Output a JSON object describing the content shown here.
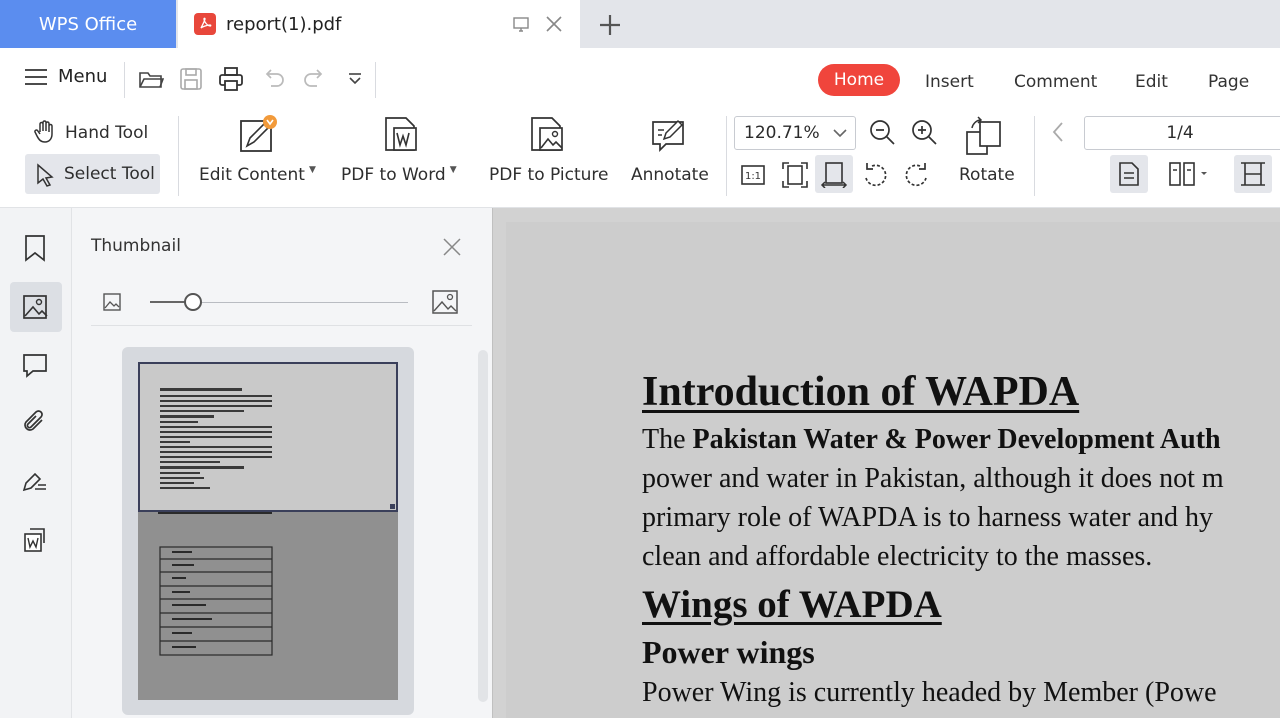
{
  "tabs": {
    "app_label": "WPS Office",
    "doc_title": "report(1).pdf"
  },
  "menu": {
    "label": "Menu"
  },
  "nav_tabs": [
    "Home",
    "Insert",
    "Comment",
    "Edit",
    "Page"
  ],
  "active_nav_tab": "Home",
  "toolbar": {
    "hand_tool": "Hand Tool",
    "select_tool": "Select Tool",
    "edit_content": "Edit Content",
    "pdf_to_word": "PDF to Word",
    "pdf_to_picture": "PDF to Picture",
    "annotate": "Annotate",
    "zoom_value": "120.71%",
    "rotate": "Rotate",
    "page_indicator": "1/4"
  },
  "thumbnail_panel": {
    "title": "Thumbnail"
  },
  "document": {
    "lines": [
      {
        "text": "Introduction of WAPDA",
        "style": "h1"
      },
      {
        "text_parts": [
          "The ",
          "Pakistan Water & Power Development Auth"
        ],
        "style": "para-mixed"
      },
      {
        "text": "power and water in Pakistan, although it does not m",
        "style": "para"
      },
      {
        "text": "primary role of WAPDA is to harness water and hy",
        "style": "para"
      },
      {
        "text": "clean and affordable electricity to the masses.",
        "style": "para"
      },
      {
        "text": "Wings of WAPDA",
        "style": "h2"
      },
      {
        "text": "Power wings",
        "style": "h3"
      },
      {
        "text": "Power Wing is currently headed by Member (Powe",
        "style": "para"
      }
    ]
  },
  "colors": {
    "accent_blue": "#5b8def",
    "home_tab_red": "#f0453c",
    "pdf_icon_red": "#e8473b"
  }
}
